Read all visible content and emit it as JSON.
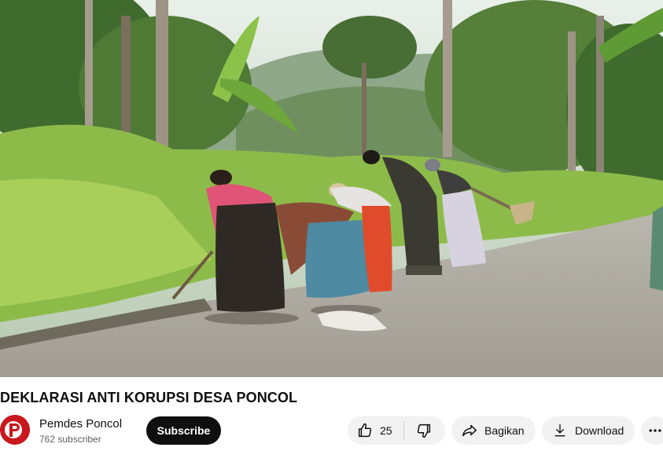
{
  "video": {
    "title": "DEKLARASI ANTI KORUPSI DESA PONCOL",
    "thumbnail_description": "Village women sweeping a rural road lined with tall grass and trees"
  },
  "channel": {
    "name": "Pemdes Poncol",
    "subscribers": "762 subscriber",
    "avatar_letter": "P"
  },
  "actions": {
    "subscribe_label": "Subscribe",
    "like_count": "25",
    "share_label": "Bagikan",
    "download_label": "Download"
  },
  "icons": [
    "thumbs-up-icon",
    "thumbs-down-icon",
    "share-icon",
    "download-icon",
    "more-icon"
  ],
  "colors": {
    "subscribe_bg": "#0f0f0f",
    "pill_bg": "#f2f2f2",
    "avatar_bg": "#c8171d"
  }
}
